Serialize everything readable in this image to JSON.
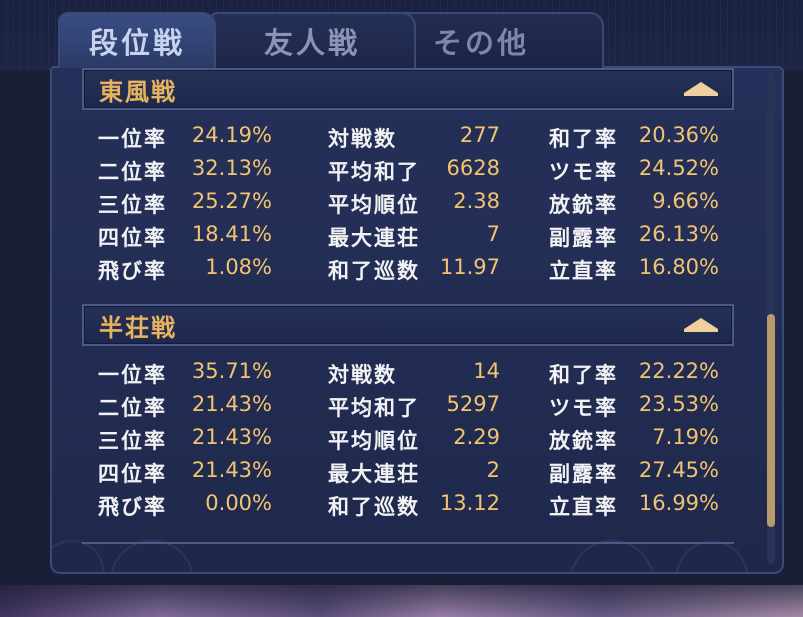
{
  "tabs": [
    {
      "label": "段位戦",
      "active": true
    },
    {
      "label": "友人戦",
      "active": false
    },
    {
      "label": "その他",
      "active": false
    }
  ],
  "sections": [
    {
      "title": "東風戦",
      "columns": [
        [
          {
            "label": "一位率",
            "value": "24.19%"
          },
          {
            "label": "二位率",
            "value": "32.13%"
          },
          {
            "label": "三位率",
            "value": "25.27%"
          },
          {
            "label": "四位率",
            "value": "18.41%"
          },
          {
            "label": "飛び率",
            "value": "1.08%"
          }
        ],
        [
          {
            "label": "対戦数",
            "value": "277"
          },
          {
            "label": "平均和了",
            "value": "6628"
          },
          {
            "label": "平均順位",
            "value": "2.38"
          },
          {
            "label": "最大連荘",
            "value": "7"
          },
          {
            "label": "和了巡数",
            "value": "11.97"
          }
        ],
        [
          {
            "label": "和了率",
            "value": "20.36%"
          },
          {
            "label": "ツモ率",
            "value": "24.52%"
          },
          {
            "label": "放銃率",
            "value": "9.66%"
          },
          {
            "label": "副露率",
            "value": "26.13%"
          },
          {
            "label": "立直率",
            "value": "16.80%"
          }
        ]
      ]
    },
    {
      "title": "半荘戦",
      "columns": [
        [
          {
            "label": "一位率",
            "value": "35.71%"
          },
          {
            "label": "二位率",
            "value": "21.43%"
          },
          {
            "label": "三位率",
            "value": "21.43%"
          },
          {
            "label": "四位率",
            "value": "21.43%"
          },
          {
            "label": "飛び率",
            "value": "0.00%"
          }
        ],
        [
          {
            "label": "対戦数",
            "value": "14"
          },
          {
            "label": "平均和了",
            "value": "5297"
          },
          {
            "label": "平均順位",
            "value": "2.29"
          },
          {
            "label": "最大連荘",
            "value": "2"
          },
          {
            "label": "和了巡数",
            "value": "13.12"
          }
        ],
        [
          {
            "label": "和了率",
            "value": "22.22%"
          },
          {
            "label": "ツモ率",
            "value": "23.53%"
          },
          {
            "label": "放銃率",
            "value": "7.19%"
          },
          {
            "label": "副露率",
            "value": "27.45%"
          },
          {
            "label": "立直率",
            "value": "16.99%"
          }
        ]
      ]
    }
  ],
  "colors": {
    "accent": "#e8b35e",
    "value": "#f2c46f",
    "panel": "#25305a"
  }
}
